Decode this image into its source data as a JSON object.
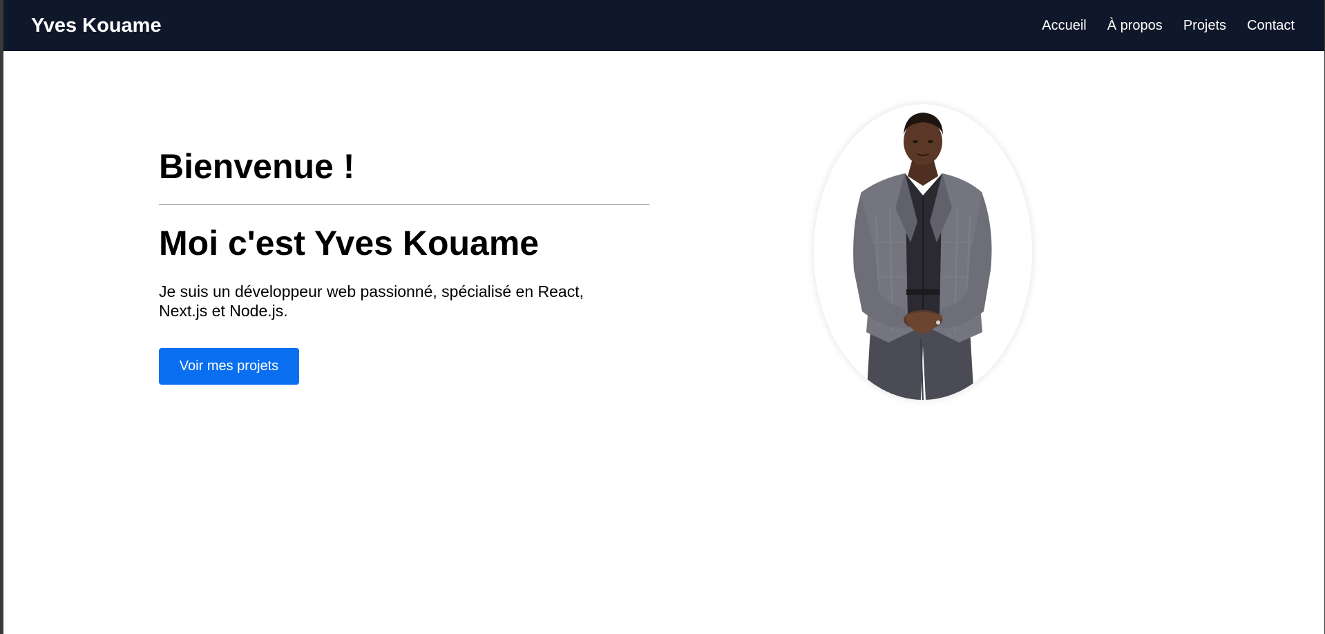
{
  "navbar": {
    "brand": "Yves Kouame",
    "links": [
      {
        "label": "Accueil"
      },
      {
        "label": "À propos"
      },
      {
        "label": "Projets"
      },
      {
        "label": "Contact"
      }
    ]
  },
  "hero": {
    "title": "Bienvenue !",
    "subtitle": "Moi c'est Yves Kouame",
    "description": "Je suis un développeur web passionné, spécialisé en React, Next.js et Node.js.",
    "cta_label": "Voir mes projets"
  },
  "colors": {
    "navbar_bg": "#0f172a",
    "accent": "#0a6ef0"
  }
}
